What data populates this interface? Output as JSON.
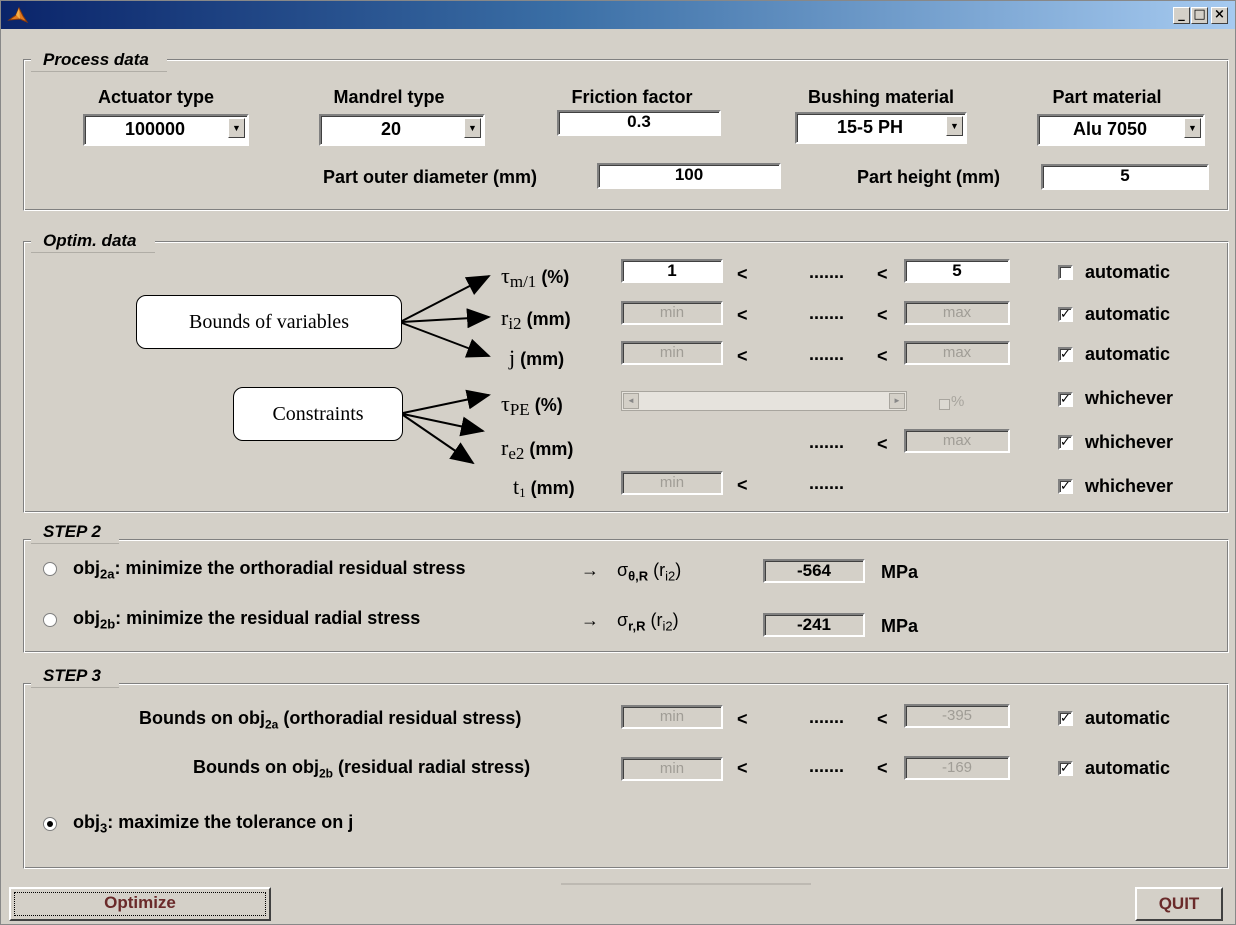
{
  "window": {
    "minimize": "_",
    "maximize": "□",
    "close": "×"
  },
  "process": {
    "title": "Process data",
    "actuator": {
      "label": "Actuator type",
      "value": "100000"
    },
    "mandrel": {
      "label": "Mandrel type",
      "value": "20"
    },
    "friction": {
      "label": "Friction factor",
      "value": "0.3"
    },
    "bushing": {
      "label": "Bushing material",
      "value": "15-5 PH"
    },
    "part_material": {
      "label": "Part material",
      "value": "Alu 7050"
    },
    "outer_diameter": {
      "label": "Part outer diameter (mm)",
      "value": "100"
    },
    "height": {
      "label": "Part height (mm)",
      "value": "5"
    }
  },
  "optim": {
    "title": "Optim. data",
    "callout_bounds": "Bounds of variables",
    "callout_constraints": "Constraints",
    "lt": "<",
    "dots": ".......",
    "tau_m1": {
      "sym": "τ",
      "sub": "m/1",
      "unit": "(%)",
      "min": "1",
      "max": "5",
      "opt": "automatic",
      "checked": false
    },
    "ri2": {
      "sym": "r",
      "sub": "i2",
      "unit": "(mm)",
      "min": "min",
      "max": "max",
      "opt": "automatic",
      "checked": true
    },
    "j": {
      "sym": "j",
      "unit": "(mm)",
      "min": "min",
      "max": "max",
      "opt": "automatic",
      "checked": true
    },
    "tau_pe": {
      "sym": "τ",
      "sub": "PE",
      "unit": "(%)",
      "pct": "%",
      "opt": "whichever",
      "checked": true
    },
    "re2": {
      "sym": "r",
      "sub": "e2",
      "unit": "(mm)",
      "max": "max",
      "opt": "whichever",
      "checked": true
    },
    "t1": {
      "sym": "t",
      "sub": "1",
      "unit": "(mm)",
      "min": "min",
      "opt": "whichever",
      "checked": true
    }
  },
  "step2": {
    "title": "STEP 2",
    "obj2a": {
      "pre": "obj",
      "sub": "2a",
      "text": ": minimize the orthoradial residual stress",
      "arrow": "→",
      "sigma": "σ",
      "sigma_sub": "θ,R",
      "r": "(r",
      "r_sub": "i2",
      "close": ")",
      "value": "-564",
      "unit": "MPa",
      "selected": false
    },
    "obj2b": {
      "pre": "obj",
      "sub": "2b",
      "text": ": minimize the residual radial stress",
      "arrow": "→",
      "sigma": "σ",
      "sigma_sub": "r,R",
      "r": "(r",
      "r_sub": "i2",
      "close": ")",
      "value": "-241",
      "unit": "MPa",
      "selected": false
    }
  },
  "step3": {
    "title": "STEP 3",
    "bounds_a": {
      "pre": "Bounds on obj",
      "sub": "2a",
      "post": " (orthoradial residual stress)",
      "min": "min",
      "max": "-395",
      "opt": "automatic",
      "checked": true
    },
    "bounds_b": {
      "pre": "Bounds on obj",
      "sub": "2b",
      "post": " (residual radial stress)",
      "min": "min",
      "max": "-169",
      "opt": "automatic",
      "checked": true
    },
    "obj3": {
      "pre": "obj",
      "sub": "3",
      "text": ": maximize the tolerance on j",
      "selected": true
    }
  },
  "buttons": {
    "optimize": "Optimize",
    "quit": "QUIT"
  },
  "colors": {
    "background": "#d4d0c8",
    "title_start": "#0a246a",
    "title_end": "#a6caf0",
    "button_text": "#6a2a2a"
  }
}
